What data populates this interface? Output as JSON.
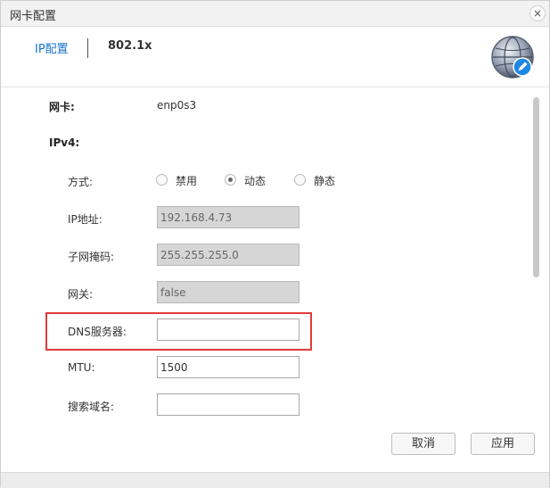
{
  "window": {
    "title": "网卡配置",
    "close_symbol": "×"
  },
  "tabs": [
    {
      "label": "IP配置",
      "active": true
    },
    {
      "label": "802.1x",
      "active": false
    }
  ],
  "icons": {
    "network_icon": "globe-edit-icon",
    "accent": "#1a73c9"
  },
  "form": {
    "nic_label": "网卡:",
    "nic_value": "enp0s3",
    "ipv4_label": "IPv4:",
    "method_label": "方式:",
    "method_options": [
      {
        "label": "禁用",
        "checked": false
      },
      {
        "label": "动态",
        "checked": true
      },
      {
        "label": "静态",
        "checked": false
      }
    ],
    "ip_label": "IP地址:",
    "ip_value": "192.168.4.73",
    "mask_label": "子网掩码:",
    "mask_value": "255.255.255.0",
    "gateway_label": "网关:",
    "gateway_value": "false",
    "dns_label": "DNS服务器:",
    "dns_value": "",
    "mtu_label": "MTU:",
    "mtu_value": "1500",
    "search_domain_label": "搜索域名:",
    "search_domain_value": ""
  },
  "buttons": {
    "cancel": "取消",
    "apply": "应用"
  },
  "highlight_color": "#e23a3a"
}
